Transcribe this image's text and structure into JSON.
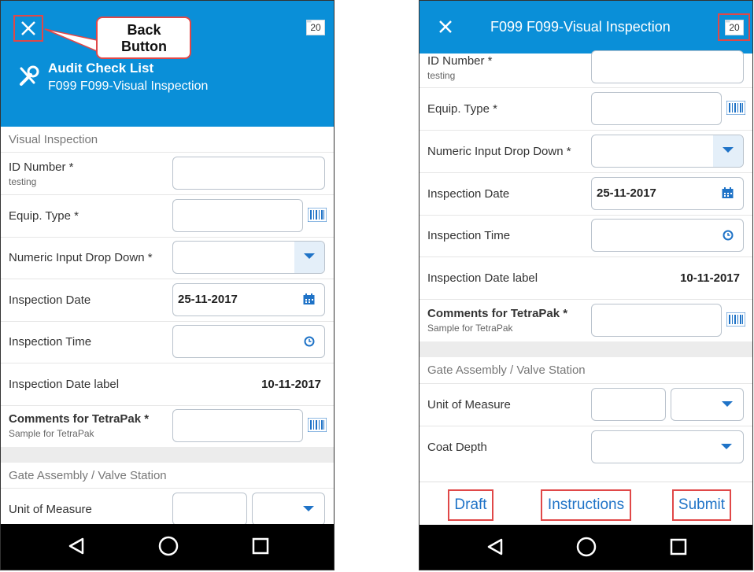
{
  "left": {
    "header": {
      "title": "Audit Check List",
      "subtitle": "F099 F099-Visual Inspection",
      "badge": "20"
    },
    "callout": {
      "text": "Back Button"
    },
    "section1": "Visual Inspection",
    "fields": {
      "id_number_label": "ID Number *",
      "id_number_sub": "testing",
      "equip_type_label": "Equip. Type *",
      "numeric_dd_label": "Numeric Input Drop Down *",
      "insp_date_label": "Inspection Date",
      "insp_date_value": "25-11-2017",
      "insp_time_label": "Inspection Time",
      "insp_date_label_label": "Inspection Date label",
      "insp_date_label_value": "10-11-2017",
      "comments_label": "Comments for TetraPak *",
      "comments_sub": "Sample for TetraPak"
    },
    "section2": "Gate Assembly / Valve Station",
    "uom_label": "Unit of Measure"
  },
  "right": {
    "header": {
      "title": "F099 F099-Visual Inspection",
      "badge": "20"
    },
    "fields": {
      "id_number_label": "ID Number *",
      "id_number_sub": "testing",
      "equip_type_label": "Equip. Type *",
      "numeric_dd_label": "Numeric Input Drop Down *",
      "insp_date_label": "Inspection Date",
      "insp_date_value": "25-11-2017",
      "insp_time_label": "Inspection Time",
      "insp_date_label_label": "Inspection Date label",
      "insp_date_label_value": "10-11-2017",
      "comments_label": "Comments for TetraPak *",
      "comments_sub": "Sample for TetraPak"
    },
    "section2": "Gate Assembly / Valve Station",
    "uom_label": "Unit of Measure",
    "coat_depth_label": "Coat Depth",
    "buttons": {
      "draft": "Draft",
      "instructions": "Instructions",
      "submit": "Submit"
    }
  },
  "colors": {
    "header_blue": "#0a8fd8",
    "accent_blue": "#1f73c7",
    "callout_border": "#e04848"
  },
  "icons": [
    "close-icon",
    "wrench-icon",
    "folder-badge-icon",
    "barcode-icon",
    "calendar-icon",
    "clock-icon",
    "dropdown-arrow-icon",
    "back-nav-icon",
    "home-nav-icon",
    "recents-nav-icon"
  ]
}
